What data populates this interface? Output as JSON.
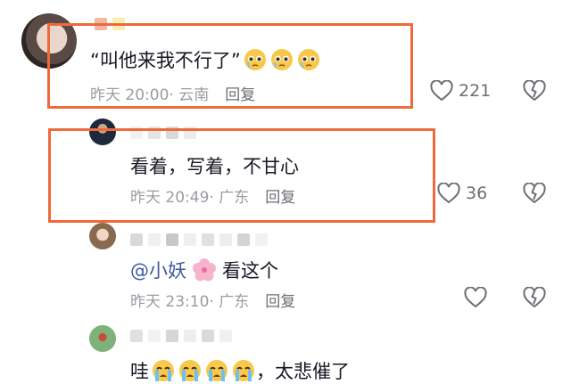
{
  "comments": [
    {
      "content": "“叫他来我不行了”",
      "emojis": [
        "crying-face",
        "crying-face",
        "crying-face"
      ],
      "time": "昨天 20:00",
      "location": "· 云南",
      "reply_label": "回复",
      "likes": "221"
    },
    {
      "content": "看着，写着，不甘心",
      "time": "昨天 20:49",
      "location": "· 广东",
      "reply_label": "回复",
      "likes": "36"
    },
    {
      "mention": "@小妖",
      "emoji": "cherry-blossom",
      "content_after": "看这个",
      "time": "昨天 23:10",
      "location": "· 广东",
      "reply_label": "回复",
      "likes": ""
    },
    {
      "content_before": "哇",
      "emojis": [
        "sob-face",
        "sob-face",
        "sob-face",
        "sob-face"
      ],
      "content_after": "，太悲催了"
    }
  ],
  "colors": {
    "highlight": "#ef6a3a",
    "meta": "#9a9ca3",
    "mention": "#3f5a9c"
  }
}
